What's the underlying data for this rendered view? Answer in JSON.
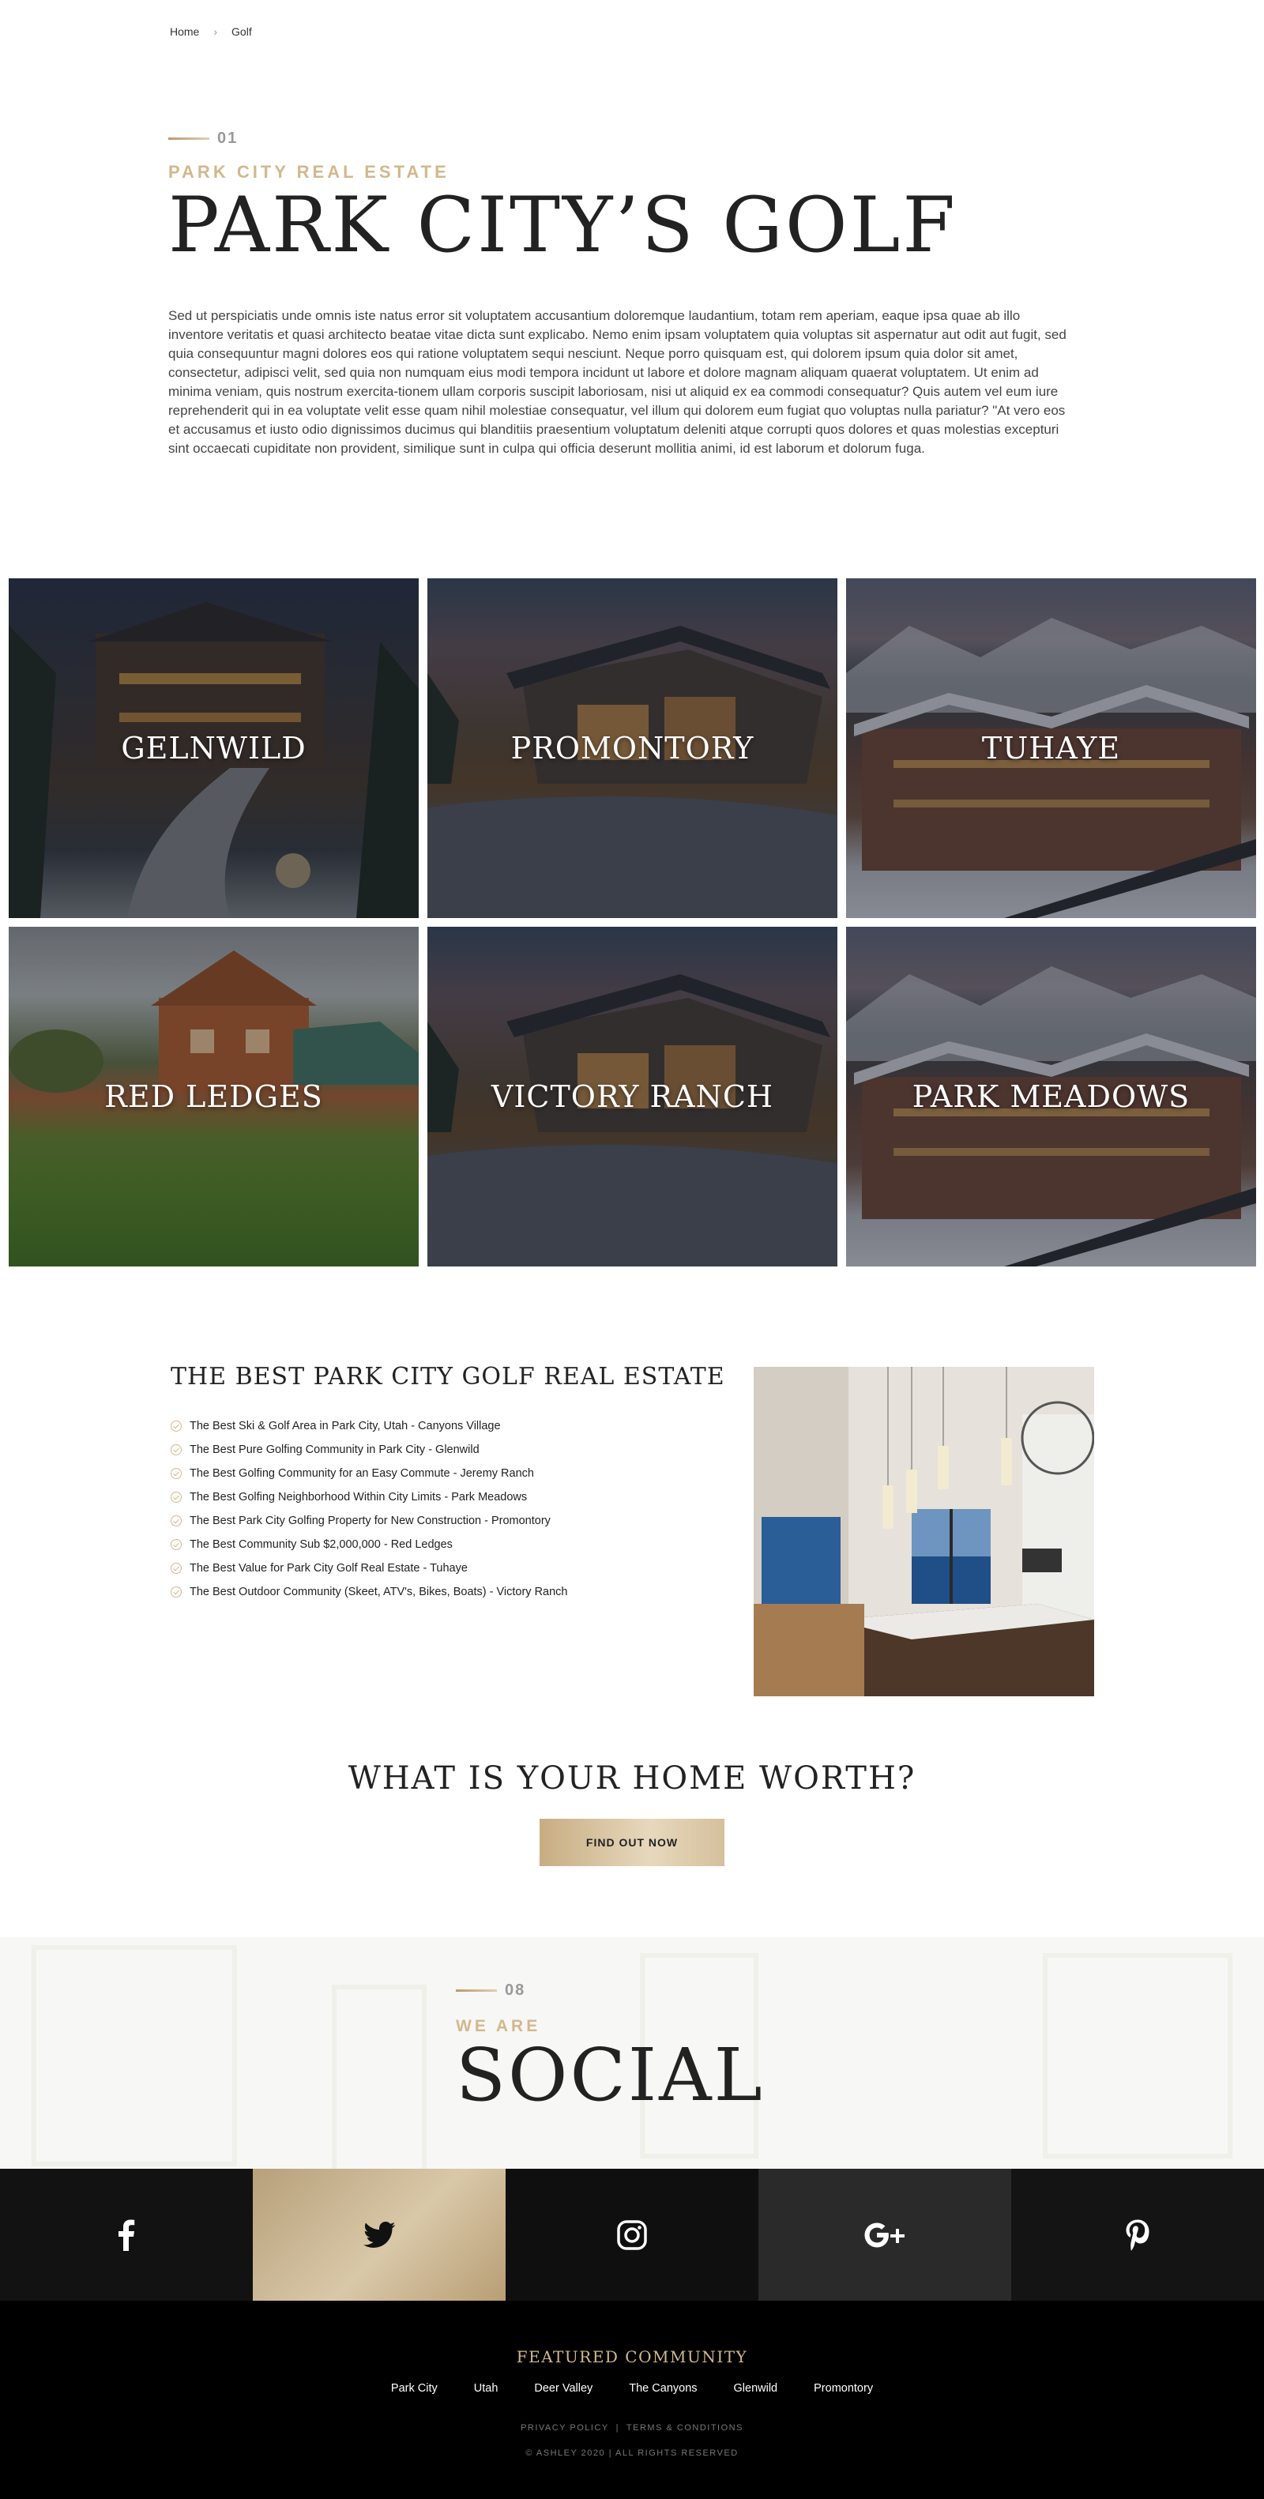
{
  "breadcrumb": {
    "home": "Home",
    "current": "Golf"
  },
  "hero": {
    "number": "01",
    "eyebrow": "PARK CITY REAL ESTATE",
    "title": "PARK CITY’S GOLF",
    "description": "Sed ut perspiciatis unde omnis iste natus error sit voluptatem accusantium doloremque laudantium, totam rem aperiam, eaque ipsa quae ab illo inventore veritatis et quasi architecto beatae vitae dicta sunt explicabo. Nemo enim ipsam voluptatem quia voluptas sit aspernatur aut odit aut fugit, sed quia consequuntur magni dolores eos qui ratione voluptatem sequi nesciunt. Neque porro quisquam est, qui dolorem ipsum quia dolor sit amet, consectetur, adipisci velit, sed quia non numquam eius modi tempora incidunt ut labore et dolore magnam aliquam quaerat voluptatem. Ut enim ad minima veniam, quis nostrum exercita-tionem ullam corporis suscipit laboriosam, nisi ut aliquid ex ea commodi consequatur? Quis autem vel eum iure reprehenderit qui in ea voluptate velit esse quam nihil molestiae consequatur, vel illum qui dolorem eum fugiat quo voluptas nulla pariatur? \"At vero eos et accusamus et iusto odio dignissimos ducimus qui blanditiis praesentium voluptatum deleniti atque corrupti quos dolores et quas molestias excepturi sint occaecati cupiditate non provident, similique sunt in culpa qui officia deserunt mollitia animi, id est laborum et dolorum fuga."
  },
  "communities": [
    {
      "name": "GELNWILD"
    },
    {
      "name": "PROMONTORY"
    },
    {
      "name": "TUHAYE"
    },
    {
      "name": "RED LEDGES"
    },
    {
      "name": "VICTORY RANCH"
    },
    {
      "name": "PARK MEADOWS"
    }
  ],
  "best": {
    "title": "THE BEST PARK CITY GOLF REAL ESTATE",
    "items": [
      "The Best Ski & Golf Area in Park City, Utah - Canyons Village",
      "The Best Pure Golfing Community in Park City - Glenwild",
      "The Best Golfing Community for an Easy Commute - Jeremy Ranch",
      "The Best Golfing Neighborhood Within City Limits - Park Meadows",
      "The Best Park City Golfing Property for New Construction - Promontory",
      "The Best Community Sub $2,000,000 - Red Ledges",
      "The Best Value for Park City Golf Real Estate - Tuhaye",
      "The Best Outdoor Community (Skeet, ATV's, Bikes, Boats) - Victory Ranch"
    ]
  },
  "worth": {
    "title": "WHAT IS YOUR HOME WORTH?",
    "button": "FIND OUT NOW"
  },
  "social": {
    "number": "08",
    "eyebrow": "WE ARE",
    "title": "SOCIAL",
    "networks": [
      "facebook-icon",
      "twitter-icon",
      "instagram-icon",
      "google-plus-icon",
      "pinterest-icon"
    ]
  },
  "footer": {
    "title": "FEATURED COMMUNITY",
    "links": [
      "Park City",
      "Utah",
      "Deer Valley",
      "The Canyons",
      "Glenwild",
      "Promontory"
    ],
    "legal": "PRIVACY POLICY  |  TERMS & CONDITIONS",
    "copyright": "© ASHLEY 2020 | ALL RIGHTS RESERVED"
  },
  "colors": {
    "accent": "#d1b88d",
    "dark": "#222222",
    "footer_bg": "#000000"
  }
}
